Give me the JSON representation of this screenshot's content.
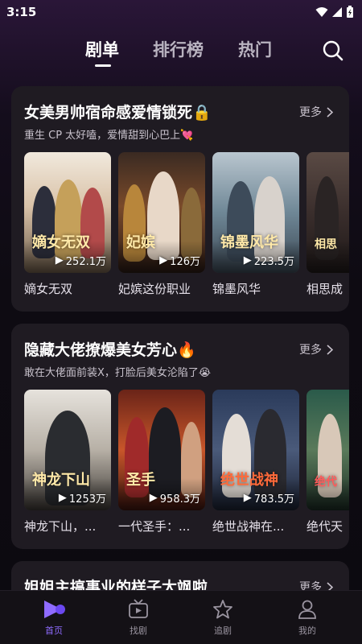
{
  "status_bar": {
    "time": "3:15"
  },
  "top_tabs": [
    {
      "label": "剧单",
      "active": true
    },
    {
      "label": "排行榜",
      "active": false
    },
    {
      "label": "热门",
      "active": false
    }
  ],
  "sections": [
    {
      "title": "女美男帅宿命感爱情锁死🔒",
      "subtitle": "重生 CP 太好嗑，爱情甜到心巴上💘",
      "more_label": "更多",
      "cards": [
        {
          "title": "嫡女无双",
          "poster_text": "嫡女无双",
          "plays": "252.1万"
        },
        {
          "title": "妃嫔这份职业",
          "poster_text": "妃嫔",
          "plays": "126万"
        },
        {
          "title": "锦墨风华",
          "poster_text": "锦墨风华",
          "plays": "223.5万"
        },
        {
          "title": "相思成",
          "poster_text": "相思",
          "plays": ""
        }
      ]
    },
    {
      "title": "隐藏大佬撩爆美女芳心🔥",
      "subtitle": "敢在大佬面前装X，打脸后美女沦陷了😭",
      "more_label": "更多",
      "cards": [
        {
          "title": "神龙下山，...",
          "poster_text": "神龙下山",
          "plays": "1253万"
        },
        {
          "title": "一代圣手：...",
          "poster_text": "圣手",
          "plays": "958.3万"
        },
        {
          "title": "绝世战神在...",
          "poster_text": "绝世战神",
          "plays": "783.5万"
        },
        {
          "title": "绝代天",
          "poster_text": "绝代",
          "plays": ""
        }
      ]
    },
    {
      "title": "姐姐主搞事业的样子太飒啦",
      "more_label": "更多"
    }
  ],
  "bottom_nav": [
    {
      "label": "首页",
      "icon": "home-play-icon",
      "active": true
    },
    {
      "label": "找剧",
      "icon": "tv-icon",
      "active": false
    },
    {
      "label": "追剧",
      "icon": "star-icon",
      "active": false
    },
    {
      "label": "我的",
      "icon": "person-icon",
      "active": false
    }
  ],
  "colors": {
    "accent": "#8f6bff",
    "card_bg": "#1f1b22",
    "page_bg": "#0c0a10"
  }
}
